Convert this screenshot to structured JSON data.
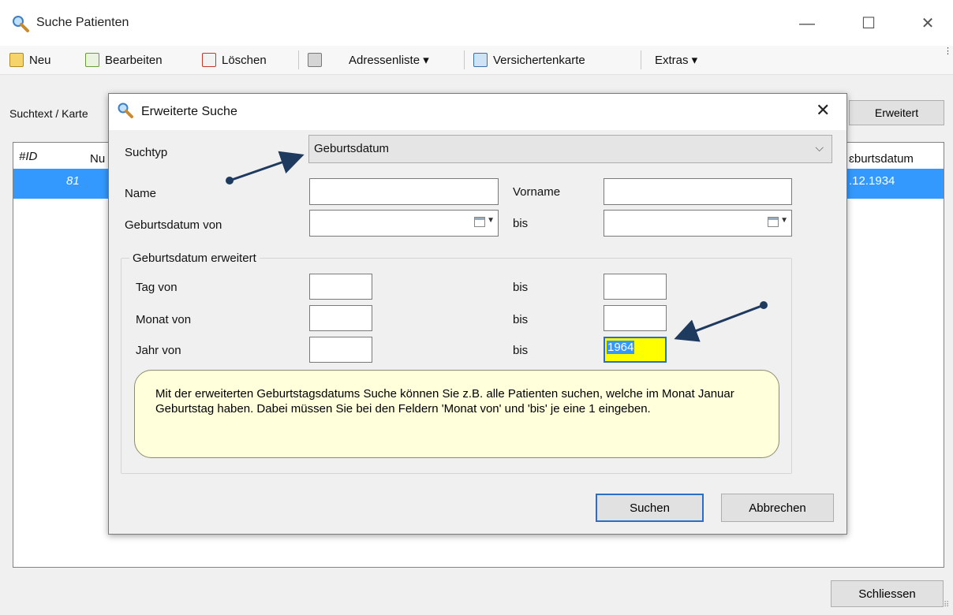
{
  "window": {
    "title": "Suche Patienten",
    "controls": [
      "—",
      "☐",
      "✕"
    ]
  },
  "toolbar": {
    "neu": "Neu",
    "bearbeiten": "Bearbeiten",
    "loeschen": "Löschen",
    "adressenliste": "Adressenliste ▾",
    "versichertenkarte": "Versichertenkarte",
    "extras": "Extras ▾"
  },
  "search": {
    "label": "Suchtext / Karte",
    "erweitert_button": "Erweitert"
  },
  "grid": {
    "columns": [
      "#ID",
      "Nu",
      "ɛburtsdatum"
    ],
    "row": {
      "id": "81",
      "birthdate": ".12.1934"
    }
  },
  "footer": {
    "close_button": "Schliessen"
  },
  "dialog": {
    "title": "Erweiterte Suche",
    "close": "✕",
    "suchtyp_label": "Suchtyp",
    "suchtyp_value": "Geburtsdatum",
    "name_label": "Name",
    "vorname_label": "Vorname",
    "geburtsdatum_von_label": "Geburtsdatum von",
    "bis_label": "bis",
    "group_title": "Geburtsdatum erweitert",
    "tag_von_label": "Tag von",
    "monat_von_label": "Monat von",
    "jahr_von_label": "Jahr von",
    "jahr_bis_value": "1964",
    "note": "Mit der erweiterten Geburtstagsdatums Suche können Sie z.B. alle Patienten suchen, welche im Monat Januar Geburtstag haben. Dabei müssen Sie bei den Feldern 'Monat von' und 'bis' je eine 1 eingeben.",
    "suchen_button": "Suchen",
    "abbrechen_button": "Abbrechen"
  },
  "colors": {
    "selection": "#3399ff",
    "annotation_arrow": "#1f3a5f",
    "highlight": "#ffff00",
    "note_bg": "#ffffdc"
  }
}
